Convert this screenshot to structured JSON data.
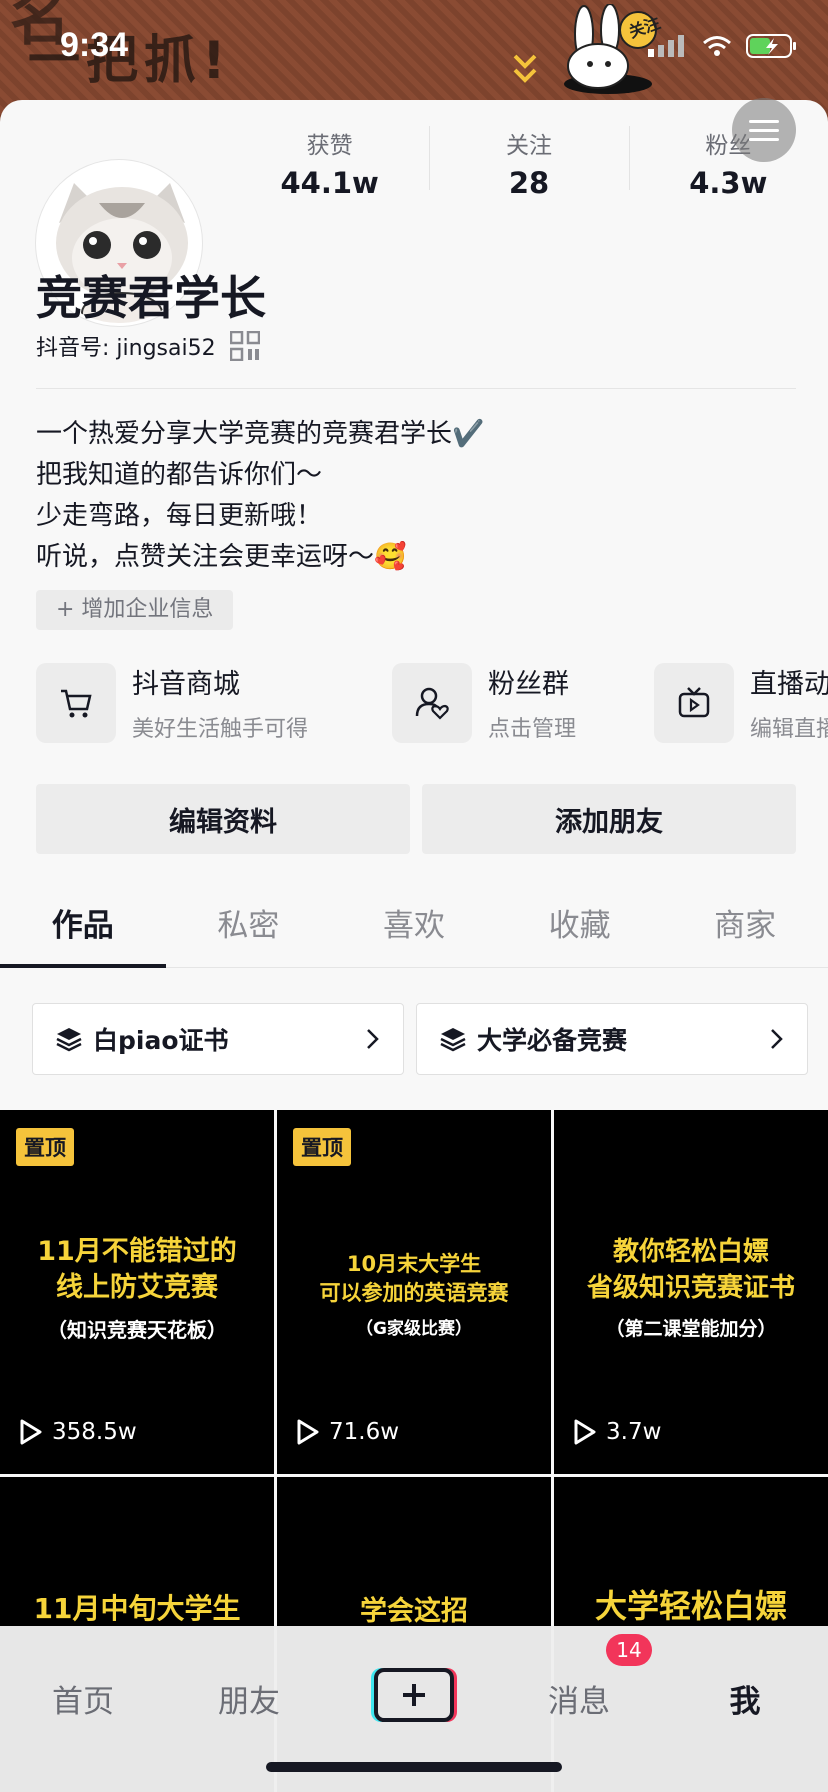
{
  "status_bar": {
    "time": "9:34"
  },
  "banner": {
    "text": "一把抓!",
    "bunny_tag": "关注"
  },
  "profile": {
    "nickname": "竞赛君学长",
    "douyin_id": "抖音号: jingsai52",
    "stats": [
      {
        "label": "获赞",
        "value": "44.1w"
      },
      {
        "label": "关注",
        "value": "28"
      },
      {
        "label": "粉丝",
        "value": "4.3w"
      }
    ],
    "bio": [
      "一个热爱分享大学竞赛的竞赛君学长✔️",
      "把我知道的都告诉你们～",
      "少走弯路，每日更新哦！",
      "听说，点赞关注会更幸运呀～🥰"
    ],
    "add_enterprise": "+ 增加企业信息"
  },
  "services": [
    {
      "title": "抖音商城",
      "subtitle": "美好生活触手可得",
      "icon": "cart-icon"
    },
    {
      "title": "粉丝群",
      "subtitle": "点击管理",
      "icon": "fan-group-icon"
    },
    {
      "title": "直播动态",
      "subtitle": "编辑直播",
      "icon": "live-icon"
    }
  ],
  "buttons": {
    "edit": "编辑资料",
    "add_friend": "添加朋友"
  },
  "tabs": [
    "作品",
    "私密",
    "喜欢",
    "收藏",
    "商家"
  ],
  "collections": [
    {
      "label": "白piao证书"
    },
    {
      "label": "大学必备竞赛"
    }
  ],
  "videos": [
    {
      "pinned": true,
      "pin_label": "置顶",
      "title": "11月不能错过的\n线上防艾竞赛",
      "sub": "（知识竞赛天花板）",
      "views": "358.5w"
    },
    {
      "pinned": true,
      "pin_label": "置顶",
      "title": "10月末大学生\n可以参加的英语竞赛",
      "sub": "（G家级比赛）",
      "views": "71.6w"
    },
    {
      "pinned": false,
      "title": "教你轻松白嫖\n省级知识竞赛证书",
      "sub": "（第二课堂能加分）",
      "views": "3.7w"
    },
    {
      "pinned": false,
      "title": "11月中旬大学生",
      "sub": "",
      "views": ""
    },
    {
      "pinned": false,
      "title": "学会这招",
      "sub": "",
      "views": ""
    },
    {
      "pinned": false,
      "title": "大学轻松白嫖",
      "sub": "",
      "views": ""
    }
  ],
  "bottom_nav": {
    "items": [
      "首页",
      "朋友",
      "消息",
      "我"
    ],
    "message_badge": "14"
  },
  "colors": {
    "accent_red": "#f2355a",
    "pin_yellow": "#f5c33b",
    "video_title_yellow": "#f6d43a",
    "banner_brown": "#8a4b33"
  }
}
